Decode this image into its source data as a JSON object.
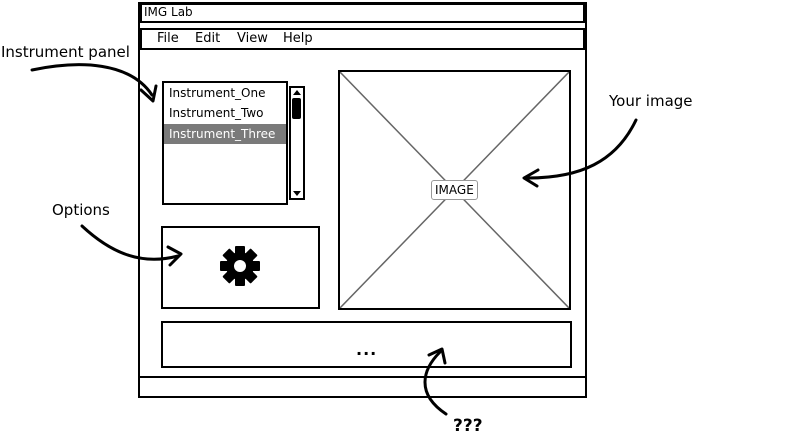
{
  "window": {
    "title": "IMG Lab",
    "menu": [
      "File",
      "Edit",
      "View",
      "Help"
    ]
  },
  "instrument_list": {
    "items": [
      "Instrument_One",
      "Instrument_Two",
      "Instrument_Three"
    ],
    "selected": "Instrument_Three"
  },
  "options": {
    "icon": "gear-icon"
  },
  "image_placeholder": {
    "label": "IMAGE"
  },
  "bottom_panel": {
    "text": "..."
  },
  "annotations": {
    "instrument_panel": "Instrument panel",
    "options": "Options",
    "your_image": "Your image",
    "bottom": "???"
  }
}
